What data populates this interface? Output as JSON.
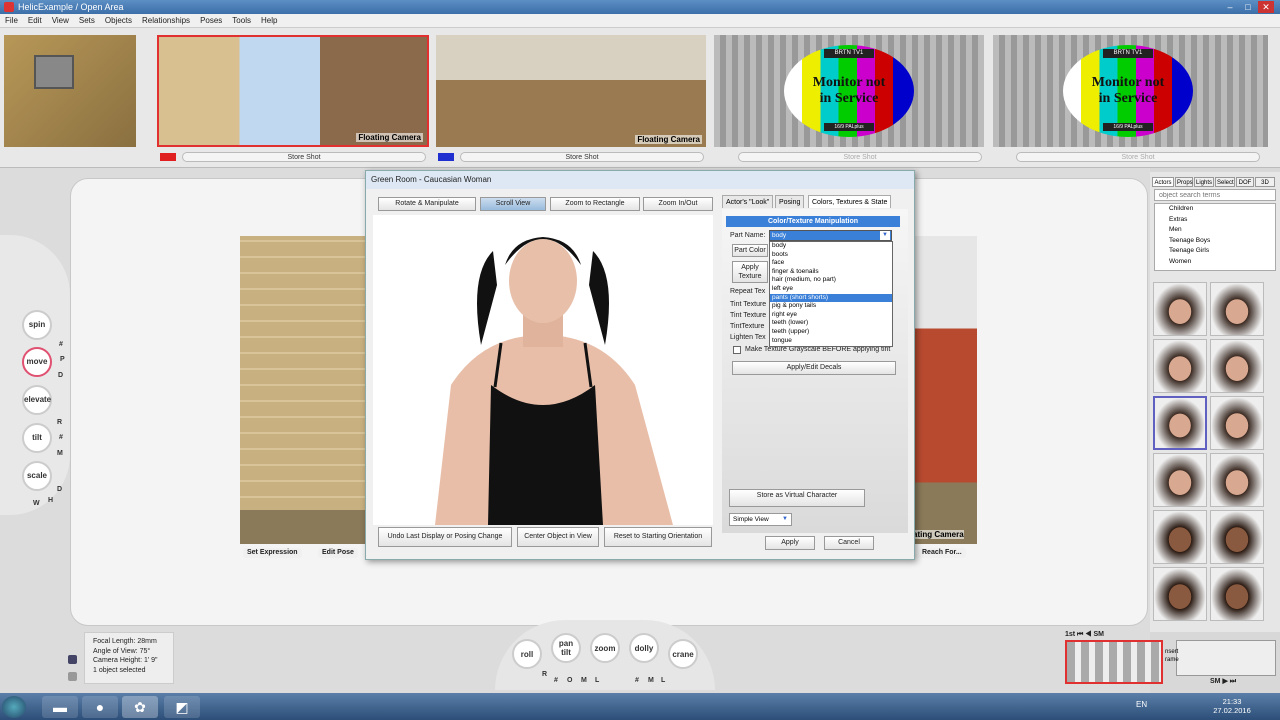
{
  "window": {
    "title": "HelicExample  /  Open Area"
  },
  "menu": [
    "File",
    "Edit",
    "View",
    "Sets",
    "Objects",
    "Relationships",
    "Poses",
    "Tools",
    "Help"
  ],
  "cameras": [
    {
      "caption": "Floating Camera",
      "store": "Store Shot"
    },
    {
      "caption": "Floating Camera",
      "store": "Store Shot"
    },
    {
      "top": "BRTN TV1",
      "msg1": "Monitor not",
      "msg2": "in Service",
      "bottom": "16/9 PALplus",
      "store": "Store Shot"
    },
    {
      "top": "BRTN TV1",
      "msg1": "Monitor not",
      "msg2": "in Service",
      "bottom": "16/9 PALplus",
      "store": "Store Shot"
    }
  ],
  "left_controls": {
    "spin": "spin",
    "move": "move",
    "elevate": "elevate",
    "tilt": "tilt",
    "scale": "scale",
    "p": "P",
    "d": "D",
    "r": "R",
    "m": "M",
    "w": "W",
    "h": "H",
    "hash": "#"
  },
  "stage": {
    "set_expression": "Set Expression",
    "edit_pose": "Edit Pose",
    "reach_for": "Reach For...",
    "floating_camera": "ating Camera"
  },
  "dialog": {
    "title": "Green Room - Caucasian Woman",
    "buttons": {
      "rotate": "Rotate & Manipulate",
      "scroll": "Scroll View",
      "zoom_rect": "Zoom to Rectangle",
      "zoom_inout": "Zoom In/Out",
      "undo": "Undo Last Display or Posing Change",
      "center": "Center Object in View",
      "reset": "Reset to Starting Orientation",
      "apply": "Apply",
      "cancel": "Cancel"
    },
    "tabs": [
      "Actor's \"Look\"",
      "Posing",
      "Colors, Textures & State"
    ],
    "panel": {
      "header": "Color/Texture Manipulation",
      "part_name_label": "Part Name:",
      "part_value": "body",
      "part_color": "Part Color",
      "apply_texture_1": "Apply",
      "apply_texture_2": "Texture",
      "repeat_tex": "Repeat Tex",
      "tint1": "Tint Texture",
      "tint2": "Tint Texture",
      "tint3": "TintTexture",
      "lighten": "Lighten Tex",
      "grayscale": "Make Texture Grayscale BEFORE applying tint",
      "decals": "Apply/Edit Decals",
      "store_virtual": "Store as Virtual Character",
      "simple_view": "Simple View"
    },
    "part_options": [
      "body",
      "boots",
      "face",
      "finger & toenails",
      "hair (medium, no part)",
      "left eye",
      "pants (short shorts)",
      "pig & pony tails",
      "right eye",
      "teeth (lower)",
      "teeth (upper)",
      "tongue"
    ],
    "part_selected_index": 6
  },
  "right_panel": {
    "tabs": [
      "Actors",
      "Props",
      "Lights",
      "Select",
      "DOF",
      "3D"
    ],
    "search_placeholder": "object search terms",
    "tree": [
      "Children",
      "Extras",
      "Men",
      "Teenage Boys",
      "Teenage Girls",
      "Women"
    ]
  },
  "info": {
    "focal": "Focal Length: 28mm",
    "angle": "Angle of View: 75°",
    "height": "Camera Height: 1' 9\"",
    "selected": "1 object selected"
  },
  "bottom_controls": {
    "roll": "roll",
    "pan1": "pan",
    "pan2": "tilt",
    "zoom": "zoom",
    "dolly": "dolly",
    "crane": "crane",
    "keys": [
      "R",
      "#",
      "O",
      "M",
      "L",
      "#",
      "M",
      "L"
    ]
  },
  "mini": {
    "nav1": "1st  ⏮ ◀  SM",
    "insert1": "nsert",
    "insert2": "rame",
    "nav2": "SM ▶ ⏭"
  },
  "taskbar": {
    "lang": "EN",
    "time": "21:33",
    "date": "27.02.2016"
  }
}
